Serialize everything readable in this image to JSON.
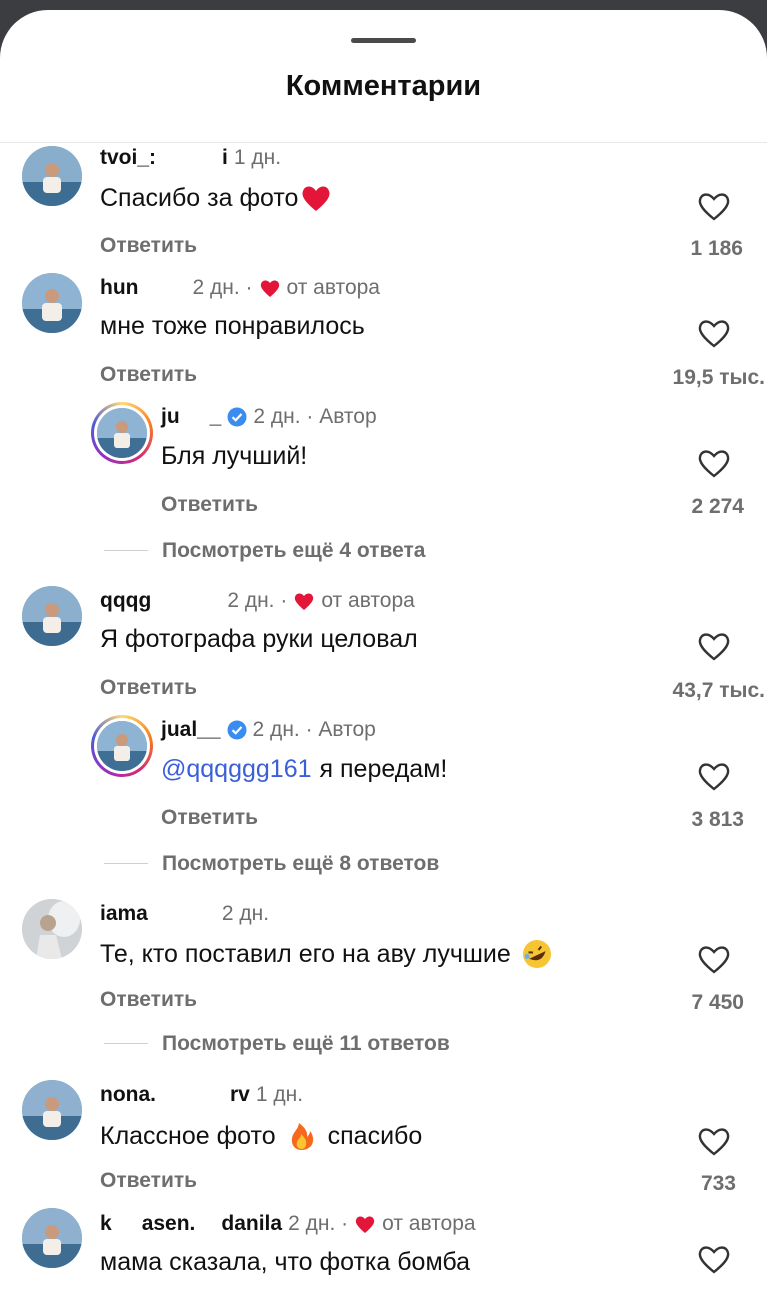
{
  "header": {
    "title": "Комментарии"
  },
  "reply_label": "Ответить",
  "comments": [
    {
      "user": "tvoi_:",
      "user_tail": "i",
      "time": "1 дн.",
      "text": "Спасибо за фото",
      "emoji": "heart-emoji",
      "likes": "1 186"
    },
    {
      "user": "hun",
      "time": "2 дн. ·",
      "author_like": "от автора",
      "text": "мне тоже понравилось",
      "likes": "19,5 тыс."
    },
    {
      "user": "ju",
      "user_tail": "_",
      "time": "2 дн. · Автор",
      "text": "Бля лучший!",
      "likes": "2 274",
      "more": "Посмотреть ещё 4 ответа"
    },
    {
      "user": "qqqg",
      "time": "2 дн. ·",
      "author_like": "от автора",
      "text": "Я фотографа руки целовал",
      "likes": "43,7 тыс."
    },
    {
      "user": "jual__",
      "time": "2 дн. · Автор",
      "mention": "@qqqggg161",
      "text": "я передам!",
      "likes": "3 813",
      "more": "Посмотреть ещё 8 ответов"
    },
    {
      "user": "iama",
      "time": "2 дн.",
      "text": "Те, кто поставил его на аву лучшие",
      "emoji": "rofl-emoji",
      "likes": "7 450",
      "more": "Посмотреть ещё 11 ответов"
    },
    {
      "user": "nona.",
      "user_tail": "rv",
      "time": "1 дн.",
      "text": "Классное фото",
      "emoji": "fire-emoji",
      "text_after": "спасибо",
      "likes": "733"
    },
    {
      "user": "k",
      "user_tail": "asen.",
      "user_tail2": "danila",
      "time": "2 дн. ·",
      "author_like": "от автора",
      "text": "мама сказала, что фотка бомба"
    }
  ],
  "colors": {
    "accent_red": "#e3163a",
    "mention_blue": "#3b5fd9",
    "verified_blue": "#3b8cf0",
    "muted": "#6e6e6e"
  }
}
